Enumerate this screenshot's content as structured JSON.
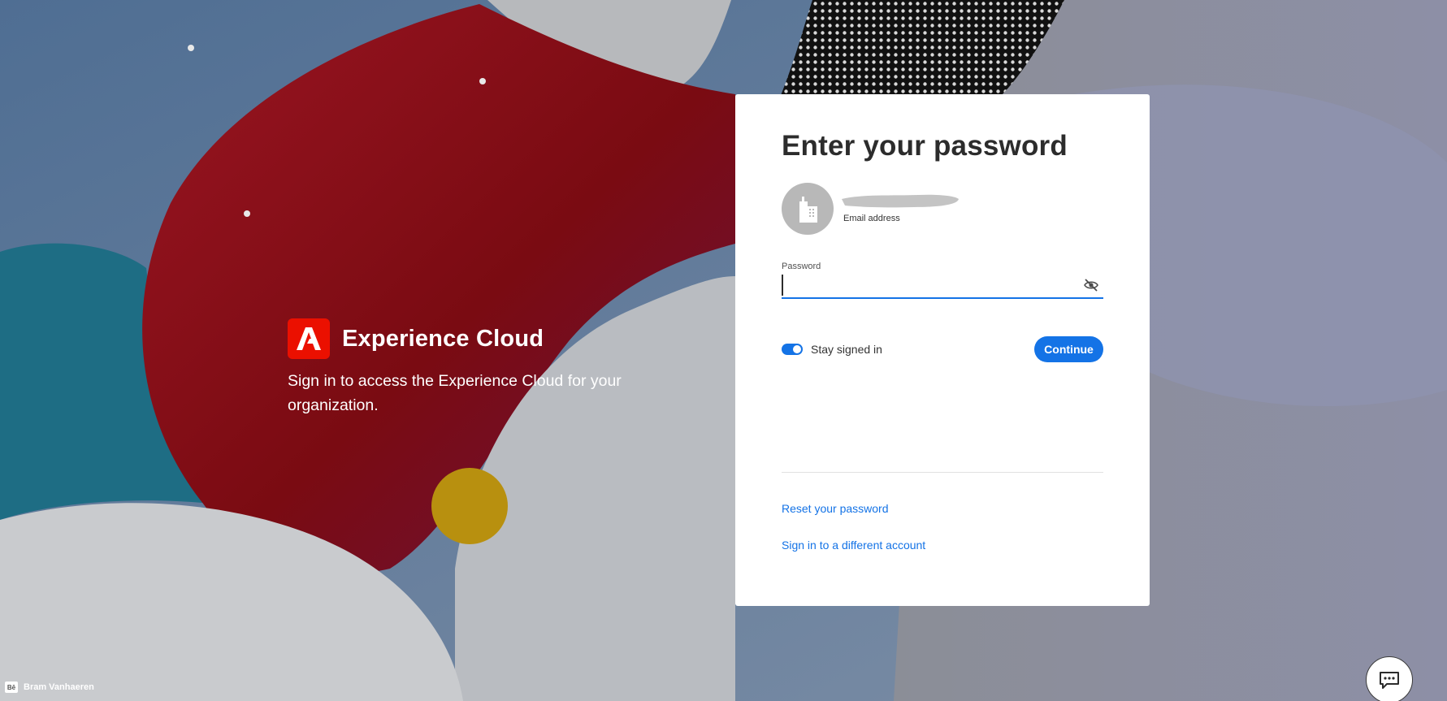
{
  "brand": {
    "title": "Experience Cloud",
    "subtitle": "Sign in to access the Experience Cloud for your organization."
  },
  "card": {
    "title": "Enter your password",
    "account": {
      "email_value": "",
      "email_label": "Email address"
    },
    "password": {
      "label": "Password",
      "value": ""
    },
    "stay_signed_in": {
      "label": "Stay signed in",
      "checked": true
    },
    "continue_label": "Continue",
    "reset_link": "Reset your password",
    "switch_account_link": "Sign in to a different account"
  },
  "credit": {
    "badge": "Bē",
    "author": "Bram Vanhaeren"
  },
  "icons": {
    "logo": "adobe-logo-icon",
    "avatar": "building-icon",
    "password_toggle": "eye-off-icon",
    "chat": "chat-icon"
  },
  "colors": {
    "accent": "#1473e6",
    "adobe_red": "#eb1000",
    "card_bg": "#ffffff",
    "title_text": "#2c2c2c"
  }
}
